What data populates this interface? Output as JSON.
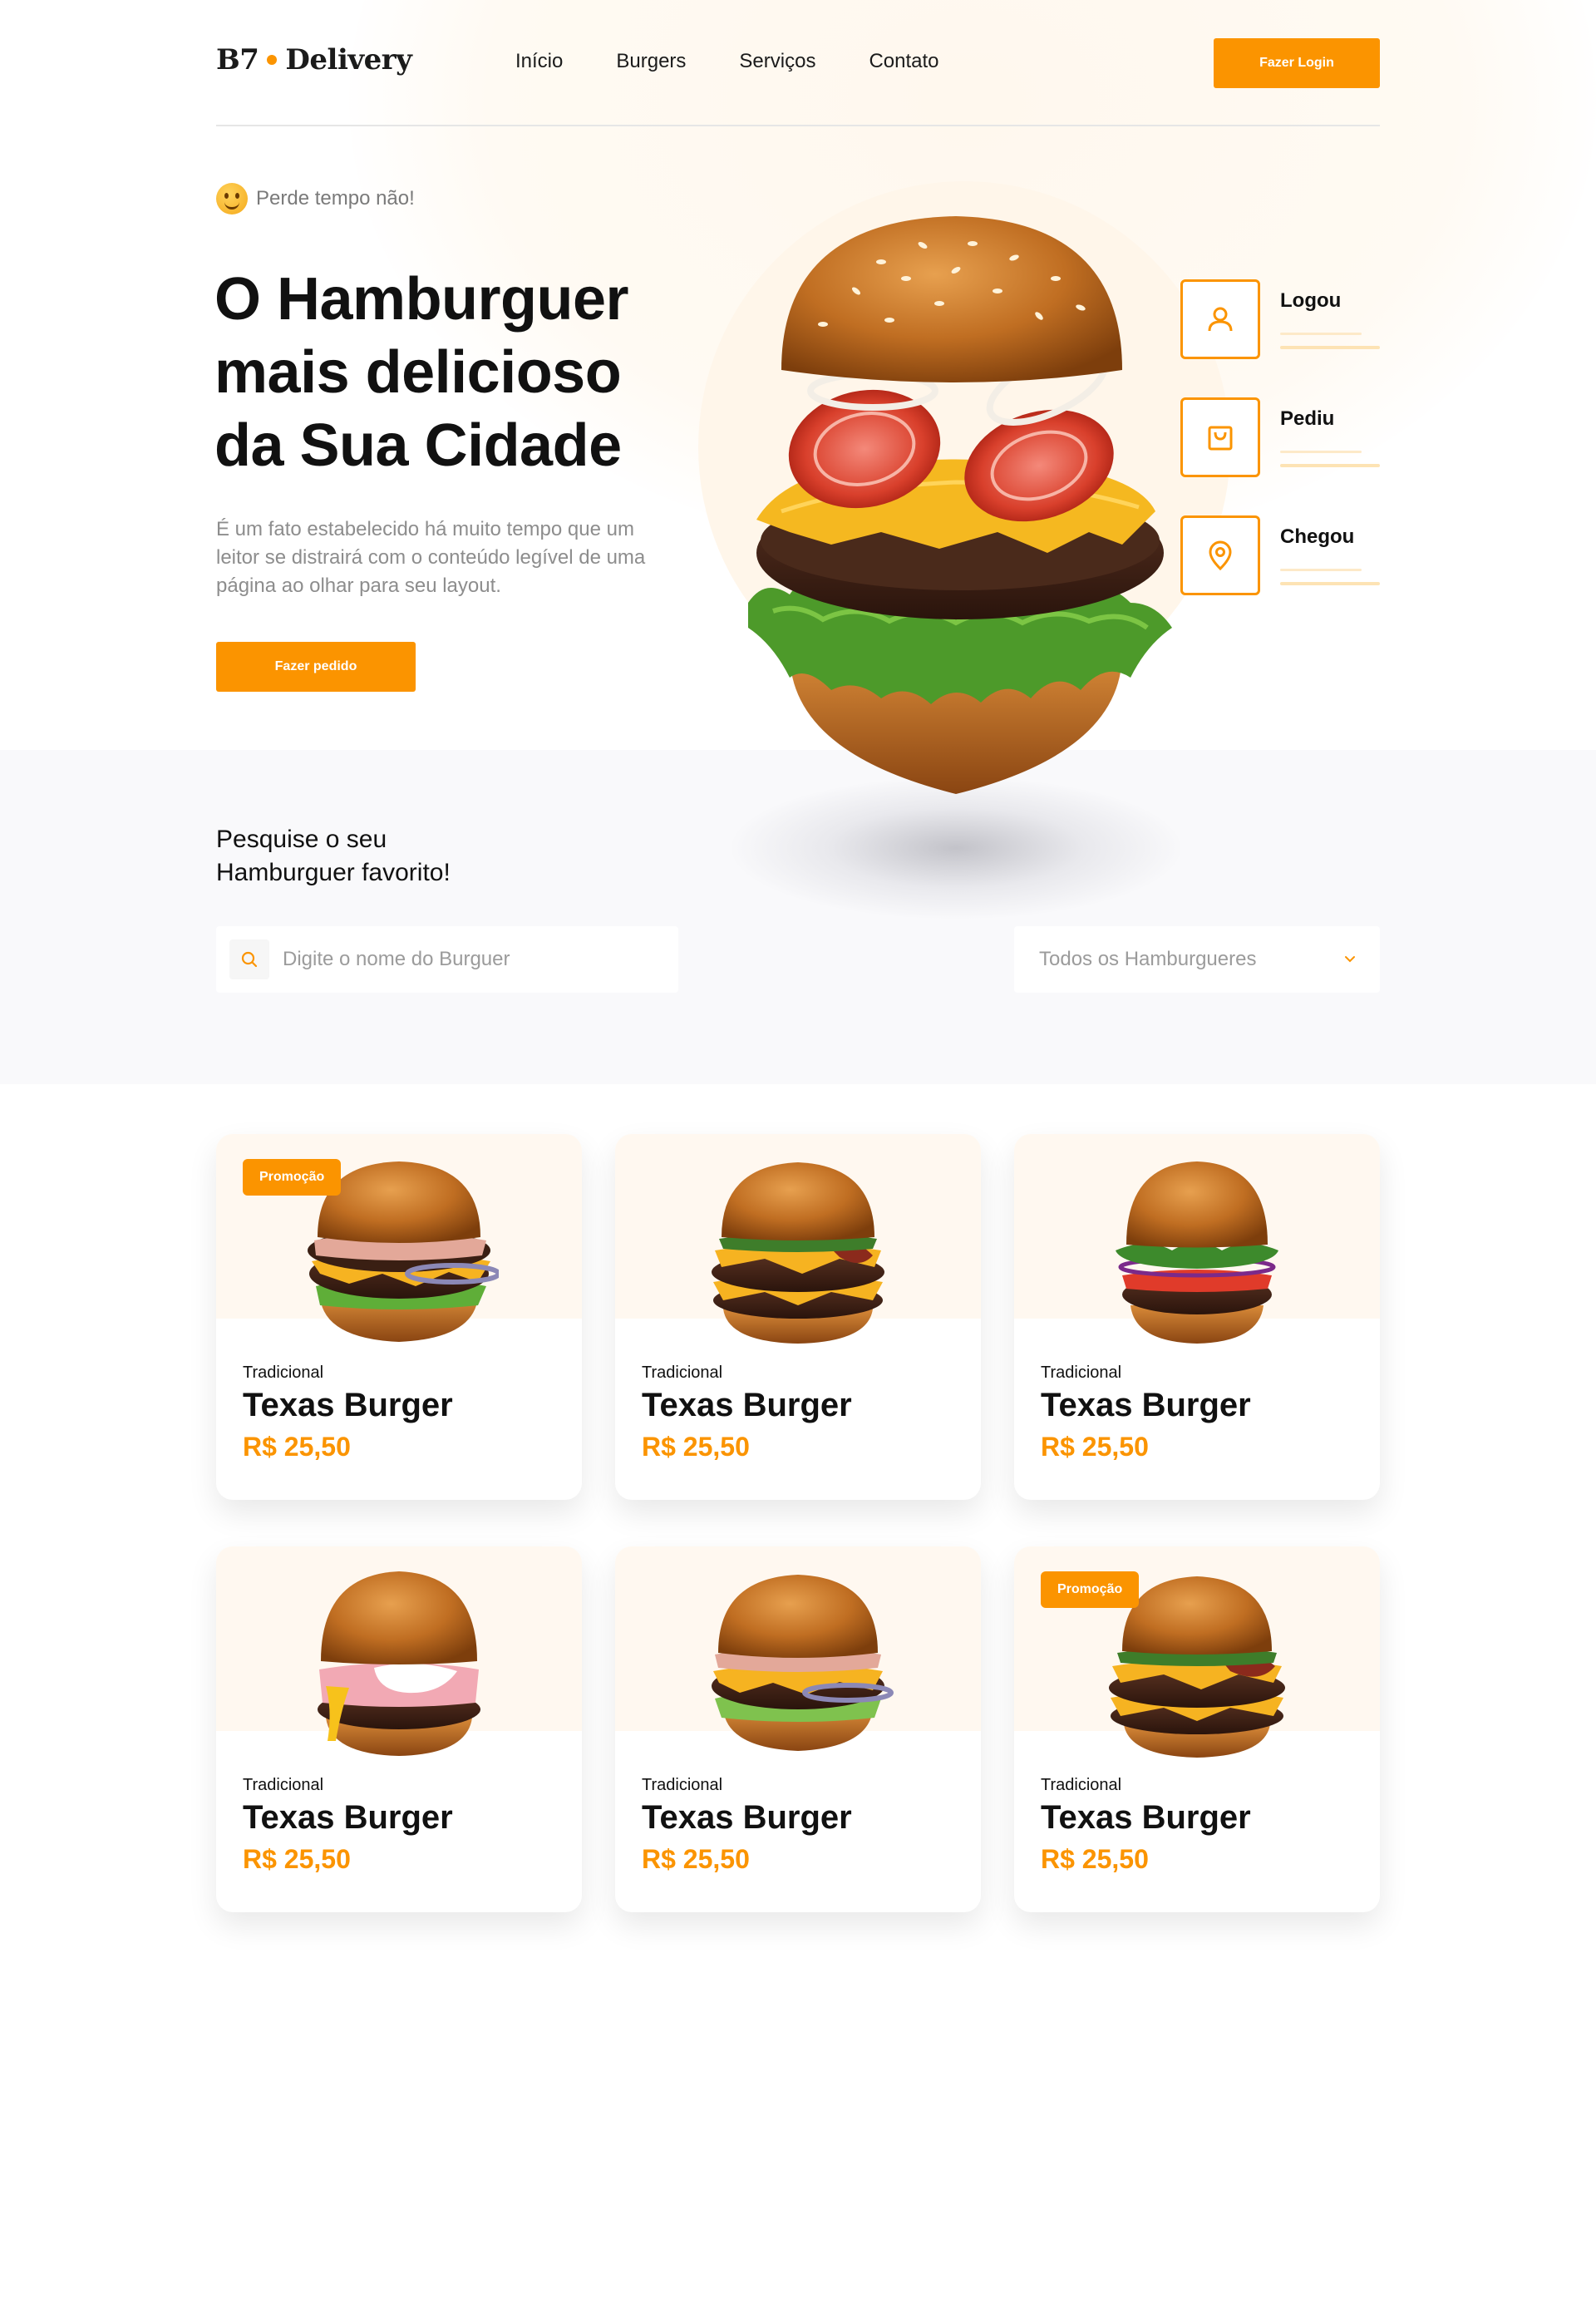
{
  "brand": {
    "part1": "B7",
    "part2": "Delivery"
  },
  "nav": {
    "items": [
      "Início",
      "Burgers",
      "Serviços",
      "Contato"
    ],
    "login_label": "Fazer Login"
  },
  "hero": {
    "tagline": "Perde tempo não!",
    "title_lines": [
      "O Hamburguer",
      "mais delicioso",
      "da Sua Cidade"
    ],
    "text": "É um fato estabelecido há muito tempo que um leitor se distrairá com o conteúdo legível de uma página ao olhar para seu layout.",
    "cta_label": "Fazer pedido"
  },
  "steps": [
    {
      "label": "Logou",
      "icon": "user-icon"
    },
    {
      "label": "Pediu",
      "icon": "bag-icon"
    },
    {
      "label": "Chegou",
      "icon": "location-pin-icon"
    }
  ],
  "search": {
    "title_lines": [
      "Pesquise o seu",
      "Hamburguer favorito!"
    ],
    "placeholder": "Digite o nome do Burguer",
    "filter_selected": "Todos os Hamburgueres"
  },
  "products": [
    {
      "badge": "Promoção",
      "category": "Tradicional",
      "name": "Texas Burger",
      "price": "R$ 25,50"
    },
    {
      "badge": "",
      "category": "Tradicional",
      "name": "Texas Burger",
      "price": "R$ 25,50"
    },
    {
      "badge": "",
      "category": "Tradicional",
      "name": "Texas Burger",
      "price": "R$ 25,50"
    },
    {
      "badge": "",
      "category": "Tradicional",
      "name": "Texas Burger",
      "price": "R$ 25,50"
    },
    {
      "badge": "",
      "category": "Tradicional",
      "name": "Texas Burger",
      "price": "R$ 25,50"
    },
    {
      "badge": "Promoção",
      "category": "Tradicional",
      "name": "Texas Burger",
      "price": "R$ 25,50"
    }
  ],
  "colors": {
    "accent": "#fb9400",
    "text": "#111111",
    "muted": "#8d8d8d",
    "band": "#f9f9fb"
  }
}
